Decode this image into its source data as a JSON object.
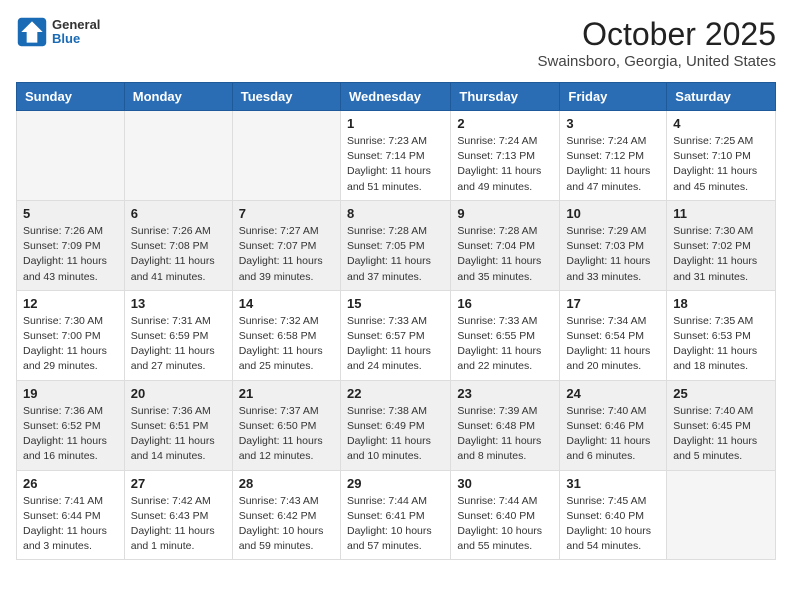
{
  "header": {
    "logo_general": "General",
    "logo_blue": "Blue",
    "month_title": "October 2025",
    "location": "Swainsboro, Georgia, United States"
  },
  "columns": [
    "Sunday",
    "Monday",
    "Tuesday",
    "Wednesday",
    "Thursday",
    "Friday",
    "Saturday"
  ],
  "weeks": [
    {
      "shaded": false,
      "days": [
        {
          "num": "",
          "info": ""
        },
        {
          "num": "",
          "info": ""
        },
        {
          "num": "",
          "info": ""
        },
        {
          "num": "1",
          "info": "Sunrise: 7:23 AM\nSunset: 7:14 PM\nDaylight: 11 hours\nand 51 minutes."
        },
        {
          "num": "2",
          "info": "Sunrise: 7:24 AM\nSunset: 7:13 PM\nDaylight: 11 hours\nand 49 minutes."
        },
        {
          "num": "3",
          "info": "Sunrise: 7:24 AM\nSunset: 7:12 PM\nDaylight: 11 hours\nand 47 minutes."
        },
        {
          "num": "4",
          "info": "Sunrise: 7:25 AM\nSunset: 7:10 PM\nDaylight: 11 hours\nand 45 minutes."
        }
      ]
    },
    {
      "shaded": true,
      "days": [
        {
          "num": "5",
          "info": "Sunrise: 7:26 AM\nSunset: 7:09 PM\nDaylight: 11 hours\nand 43 minutes."
        },
        {
          "num": "6",
          "info": "Sunrise: 7:26 AM\nSunset: 7:08 PM\nDaylight: 11 hours\nand 41 minutes."
        },
        {
          "num": "7",
          "info": "Sunrise: 7:27 AM\nSunset: 7:07 PM\nDaylight: 11 hours\nand 39 minutes."
        },
        {
          "num": "8",
          "info": "Sunrise: 7:28 AM\nSunset: 7:05 PM\nDaylight: 11 hours\nand 37 minutes."
        },
        {
          "num": "9",
          "info": "Sunrise: 7:28 AM\nSunset: 7:04 PM\nDaylight: 11 hours\nand 35 minutes."
        },
        {
          "num": "10",
          "info": "Sunrise: 7:29 AM\nSunset: 7:03 PM\nDaylight: 11 hours\nand 33 minutes."
        },
        {
          "num": "11",
          "info": "Sunrise: 7:30 AM\nSunset: 7:02 PM\nDaylight: 11 hours\nand 31 minutes."
        }
      ]
    },
    {
      "shaded": false,
      "days": [
        {
          "num": "12",
          "info": "Sunrise: 7:30 AM\nSunset: 7:00 PM\nDaylight: 11 hours\nand 29 minutes."
        },
        {
          "num": "13",
          "info": "Sunrise: 7:31 AM\nSunset: 6:59 PM\nDaylight: 11 hours\nand 27 minutes."
        },
        {
          "num": "14",
          "info": "Sunrise: 7:32 AM\nSunset: 6:58 PM\nDaylight: 11 hours\nand 25 minutes."
        },
        {
          "num": "15",
          "info": "Sunrise: 7:33 AM\nSunset: 6:57 PM\nDaylight: 11 hours\nand 24 minutes."
        },
        {
          "num": "16",
          "info": "Sunrise: 7:33 AM\nSunset: 6:55 PM\nDaylight: 11 hours\nand 22 minutes."
        },
        {
          "num": "17",
          "info": "Sunrise: 7:34 AM\nSunset: 6:54 PM\nDaylight: 11 hours\nand 20 minutes."
        },
        {
          "num": "18",
          "info": "Sunrise: 7:35 AM\nSunset: 6:53 PM\nDaylight: 11 hours\nand 18 minutes."
        }
      ]
    },
    {
      "shaded": true,
      "days": [
        {
          "num": "19",
          "info": "Sunrise: 7:36 AM\nSunset: 6:52 PM\nDaylight: 11 hours\nand 16 minutes."
        },
        {
          "num": "20",
          "info": "Sunrise: 7:36 AM\nSunset: 6:51 PM\nDaylight: 11 hours\nand 14 minutes."
        },
        {
          "num": "21",
          "info": "Sunrise: 7:37 AM\nSunset: 6:50 PM\nDaylight: 11 hours\nand 12 minutes."
        },
        {
          "num": "22",
          "info": "Sunrise: 7:38 AM\nSunset: 6:49 PM\nDaylight: 11 hours\nand 10 minutes."
        },
        {
          "num": "23",
          "info": "Sunrise: 7:39 AM\nSunset: 6:48 PM\nDaylight: 11 hours\nand 8 minutes."
        },
        {
          "num": "24",
          "info": "Sunrise: 7:40 AM\nSunset: 6:46 PM\nDaylight: 11 hours\nand 6 minutes."
        },
        {
          "num": "25",
          "info": "Sunrise: 7:40 AM\nSunset: 6:45 PM\nDaylight: 11 hours\nand 5 minutes."
        }
      ]
    },
    {
      "shaded": false,
      "days": [
        {
          "num": "26",
          "info": "Sunrise: 7:41 AM\nSunset: 6:44 PM\nDaylight: 11 hours\nand 3 minutes."
        },
        {
          "num": "27",
          "info": "Sunrise: 7:42 AM\nSunset: 6:43 PM\nDaylight: 11 hours\nand 1 minute."
        },
        {
          "num": "28",
          "info": "Sunrise: 7:43 AM\nSunset: 6:42 PM\nDaylight: 10 hours\nand 59 minutes."
        },
        {
          "num": "29",
          "info": "Sunrise: 7:44 AM\nSunset: 6:41 PM\nDaylight: 10 hours\nand 57 minutes."
        },
        {
          "num": "30",
          "info": "Sunrise: 7:44 AM\nSunset: 6:40 PM\nDaylight: 10 hours\nand 55 minutes."
        },
        {
          "num": "31",
          "info": "Sunrise: 7:45 AM\nSunset: 6:40 PM\nDaylight: 10 hours\nand 54 minutes."
        },
        {
          "num": "",
          "info": ""
        }
      ]
    }
  ]
}
